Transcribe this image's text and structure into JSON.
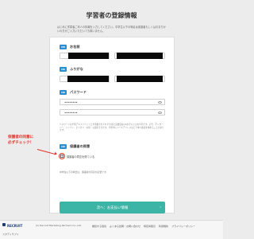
{
  "page": {
    "title": "学習者の登録情報",
    "intro": "はじめに学習者ご本人の情報を入力してください。中学生以下の場合は保護者もしくはおまちかいの方がご入力いただいても構いません。"
  },
  "form": {
    "name": {
      "badge": "OK",
      "label": "お名前"
    },
    "furigana": {
      "badge": "OK",
      "label": "ふりがな"
    },
    "password": {
      "badge": "OK",
      "label": "パスワード",
      "mask1": "••••••••",
      "mask2": "••••••••"
    },
    "password_note": "パスワードは半角アルファベットと半角数字をそれぞれ含む英数混在の6文字以上の文字列です。記号（アンダーバー、ハイフン、ピリオド、@等）も使用できます。学習中にメールアドレスなどで本人確認を求めることがあります。",
    "guardian": {
      "badge": "OK",
      "label": "保護者の同意",
      "checkbox_label": "保護者の同意を得ている",
      "sub_note": "中学生以下の場合は、保護者の同意が必要です。"
    },
    "submit": "次へ：お支払い情報"
  },
  "annotation": {
    "line1": "保護者の同意に",
    "line2": "必ずチェック！"
  },
  "footer": {
    "logo": "RECRUIT",
    "copyright": "(C) Recruit Marketing Partners Co.,Ltd.",
    "links": [
      "推奨する環境",
      "よくある質問・お問い合わせ",
      "特定商取引",
      "利用規約",
      "プライバシーポリシー"
    ],
    "bottom": "スタディサプリ"
  },
  "colors": {
    "badge": "#2a8fd1",
    "cta": "#3cb5a6",
    "annotation": "#e1332b"
  }
}
